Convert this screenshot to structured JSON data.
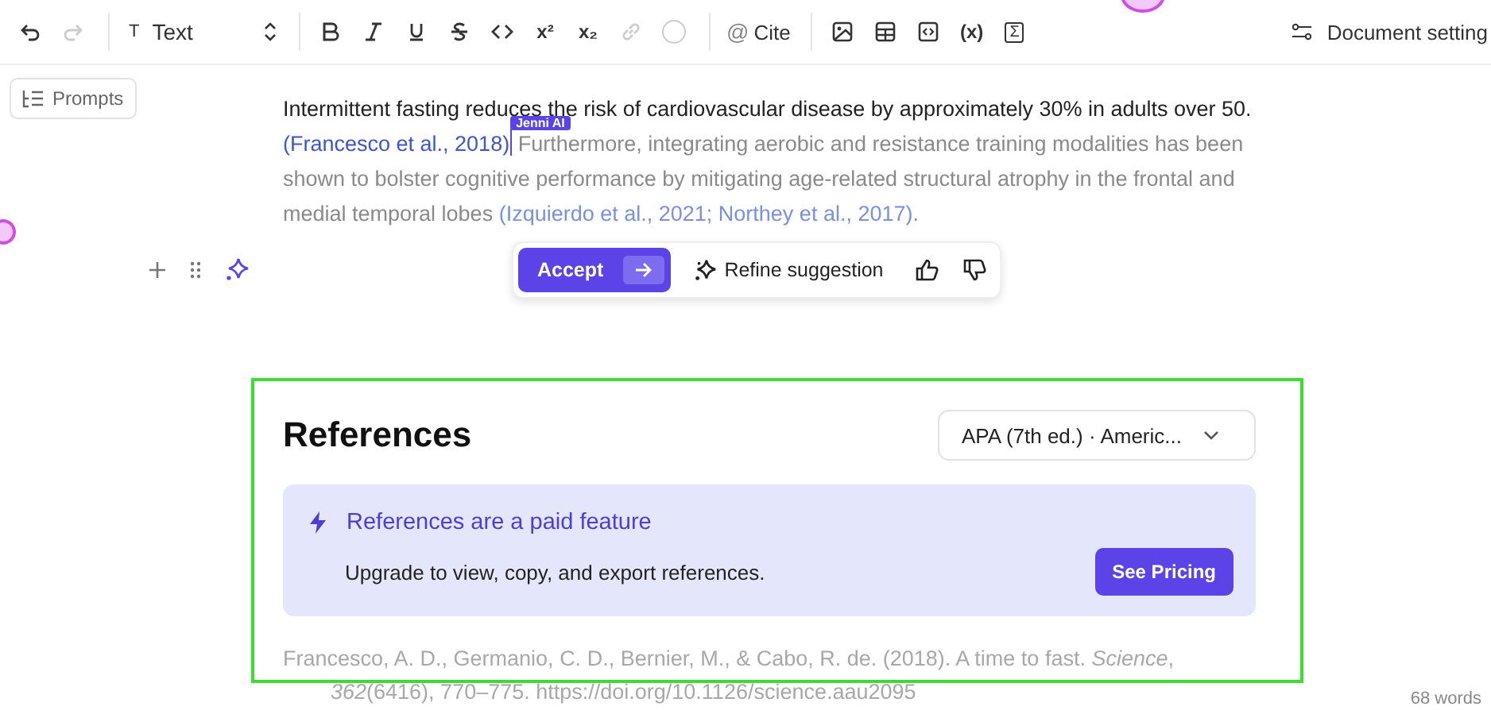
{
  "toolbar": {
    "left": [
      {
        "kind": "undo",
        "disabled": false
      },
      {
        "kind": "redo",
        "disabled": true
      }
    ],
    "block_type": {
      "icon": "T",
      "label": "Text"
    },
    "format": [
      {
        "kind": "bold",
        "disabled": false
      },
      {
        "kind": "italic",
        "disabled": false
      },
      {
        "kind": "underline",
        "disabled": false
      },
      {
        "kind": "strike",
        "disabled": false
      },
      {
        "kind": "code",
        "disabled": false
      },
      {
        "kind": "glyph",
        "label": "x²",
        "disabled": false
      },
      {
        "kind": "glyph",
        "label": "x₂",
        "disabled": false
      },
      {
        "kind": "link",
        "disabled": true
      },
      {
        "kind": "color",
        "disabled": true
      }
    ],
    "cite": {
      "icon": "@",
      "label": "Cite"
    },
    "insert": [
      {
        "kind": "image"
      },
      {
        "kind": "table"
      },
      {
        "kind": "embed"
      },
      {
        "kind": "glyph",
        "label": "(x)"
      },
      {
        "kind": "boxglyph",
        "label": "Σ"
      }
    ],
    "settings": {
      "label": "Document setting"
    }
  },
  "prompts_button": {
    "label": "Prompts"
  },
  "paragraph": {
    "segments": [
      {
        "kind": "text",
        "text": "Intermittent fasting reduces the risk of cardiovascular disease by approximately 30% in adults over 50."
      },
      {
        "kind": "citation",
        "text": "(Francesco et al., 2018)"
      },
      {
        "kind": "cursor",
        "label": "Jenni AI"
      },
      {
        "kind": "suggestion",
        "text": " Furthermore, integrating aerobic and resistance training modalities has been shown to bolster cognitive performance by mitigating age-related structural atrophy in the frontal and medial temporal lobes "
      },
      {
        "kind": "suggestion-citation",
        "text": "(Izquierdo et al., 2021; Northey et al., 2017)"
      },
      {
        "kind": "suggestion",
        "text": "."
      }
    ]
  },
  "suggestion_bar": {
    "accept": "Accept",
    "refine": "Refine suggestion"
  },
  "references": {
    "title": "References",
    "style_select": "APA (7th ed.) · Americ...",
    "banner": {
      "title": "References are a paid feature",
      "text": "Upgrade to view, copy, and export references.",
      "button": "See Pricing"
    },
    "entries": [
      "Francesco, A. D., Germanio, C. D., Bernier, M., & Cabo, R. de. (2018). A time to fast. *Science*, *362*(6416), 770–775. https://doi.org/10.1126/science.aau2095"
    ]
  },
  "word_count": "68 words"
}
